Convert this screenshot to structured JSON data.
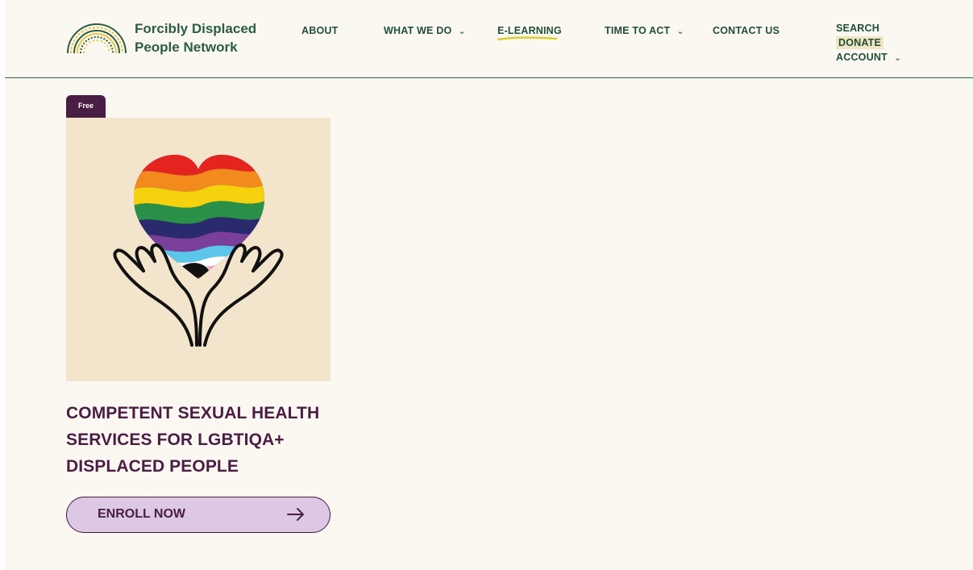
{
  "brand": {
    "line1": "Forcibly Displaced",
    "line2": "People Network"
  },
  "nav": {
    "about": "ABOUT",
    "what_we_do": "WHAT WE DO",
    "e_learning": "E-LEARNING",
    "time_to_act": "TIME TO ACT",
    "contact_us": "CONTACT US"
  },
  "utility": {
    "search": "SEARCH",
    "donate": "DONATE",
    "account": "ACCOUNT"
  },
  "icons": {
    "chevron": "chevron-down-icon",
    "arrow": "arrow-right-icon"
  },
  "course": {
    "badge": "Free",
    "title": "COMPETENT SEXUAL HEALTH SERVICES FOR LGBTIQA+ DISPLACED PEOPLE",
    "cta": "ENROLL NOW"
  },
  "colors": {
    "brand_green": "#2c5d43",
    "plum": "#4a1d44",
    "lavender": "#dcc8e4",
    "background": "#fbf8f2",
    "thumbnail_bg": "#f3e4cc",
    "highlight": "#f1e6c3"
  }
}
